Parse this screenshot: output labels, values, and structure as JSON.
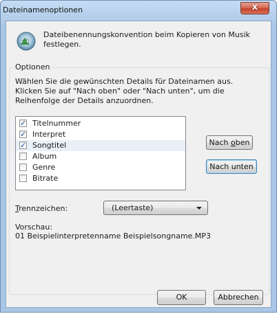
{
  "window": {
    "title": "Dateinamenoptionen",
    "close_label": "x"
  },
  "header": {
    "description": "Dateibenennungskonvention beim Kopieren von Musik festlegen."
  },
  "options": {
    "group_label": "Optionen",
    "instructions": "Wählen Sie die gewünschten Details für Dateinamen aus. Klicken Sie auf \"Nach oben\" oder \"Nach unten\", um die Reihenfolge der Details anzuordnen.",
    "items": [
      {
        "label": "Titelnummer",
        "checked": true
      },
      {
        "label": "Interpret",
        "checked": true
      },
      {
        "label": "Songtitel",
        "checked": true
      },
      {
        "label": "Album",
        "checked": false
      },
      {
        "label": "Genre",
        "checked": false
      },
      {
        "label": "Bitrate",
        "checked": false
      }
    ],
    "move_up_label_pre": "Nach ",
    "move_up_label_accel": "o",
    "move_up_label_post": "ben",
    "move_down_label": "Nach unten",
    "separator_label_accel": "T",
    "separator_label_post": "rennzeichen:",
    "separator_value": "(Leertaste)",
    "preview_label": "Vorschau:",
    "preview_text": "01 Beispielinterpretenname Beispielsongname.MP3"
  },
  "footer": {
    "ok_label": "OK",
    "cancel_label": "Abbrechen"
  },
  "colors": {
    "title_bar": "#b7d0ec",
    "close_button": "#c4412b",
    "client_bg": "#f0f0f0",
    "default_button_border": "#3c7fb1"
  },
  "icons": {
    "header": "music-cd-icon",
    "dropdown": "chevron-down-icon",
    "close": "close-icon"
  }
}
